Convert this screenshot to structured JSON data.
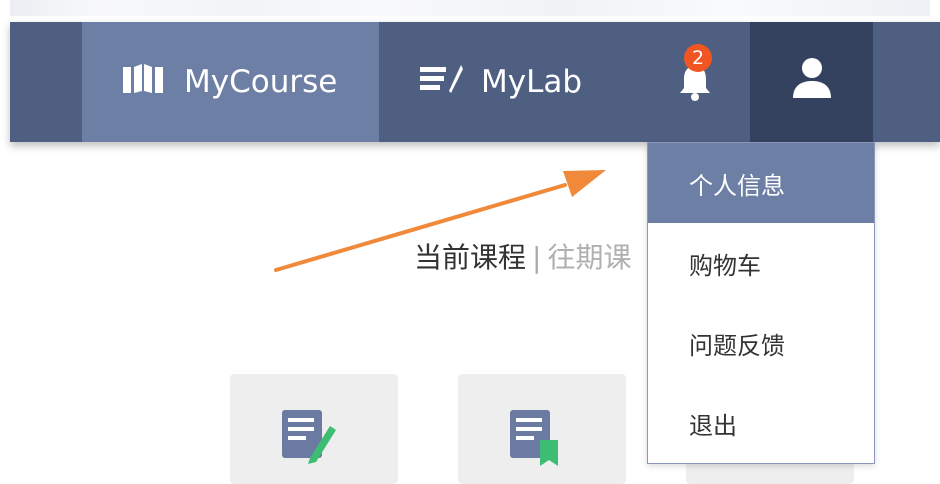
{
  "nav": {
    "mycourse_label": "MyCourse",
    "mylab_label": "MyLab",
    "notification_count": "2"
  },
  "content": {
    "current_course": "当前课程",
    "separator": "|",
    "past_course": "往期课"
  },
  "user_menu": {
    "items": [
      {
        "label": "个人信息",
        "active": true
      },
      {
        "label": "购物车"
      },
      {
        "label": "问题反馈"
      },
      {
        "label": "退出"
      }
    ]
  },
  "colors": {
    "nav_bg": "#4e5f82",
    "nav_active": "#6e7fa6",
    "nav_user": "#34425f",
    "badge": "#f05522",
    "arrow": "#f08a3a"
  },
  "icons": {
    "mycourse": "book-icon",
    "mylab": "notebook-pen-icon",
    "notifications": "bell-icon",
    "user": "user-icon"
  }
}
